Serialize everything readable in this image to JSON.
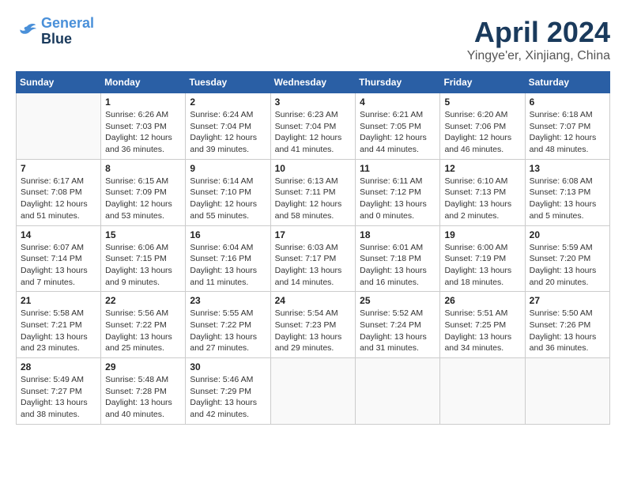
{
  "header": {
    "logo_line1": "General",
    "logo_line2": "Blue",
    "title": "April 2024",
    "location": "Yingye'er, Xinjiang, China"
  },
  "weekdays": [
    "Sunday",
    "Monday",
    "Tuesday",
    "Wednesday",
    "Thursday",
    "Friday",
    "Saturday"
  ],
  "weeks": [
    [
      {
        "day": "",
        "info": ""
      },
      {
        "day": "1",
        "info": "Sunrise: 6:26 AM\nSunset: 7:03 PM\nDaylight: 12 hours\nand 36 minutes."
      },
      {
        "day": "2",
        "info": "Sunrise: 6:24 AM\nSunset: 7:04 PM\nDaylight: 12 hours\nand 39 minutes."
      },
      {
        "day": "3",
        "info": "Sunrise: 6:23 AM\nSunset: 7:04 PM\nDaylight: 12 hours\nand 41 minutes."
      },
      {
        "day": "4",
        "info": "Sunrise: 6:21 AM\nSunset: 7:05 PM\nDaylight: 12 hours\nand 44 minutes."
      },
      {
        "day": "5",
        "info": "Sunrise: 6:20 AM\nSunset: 7:06 PM\nDaylight: 12 hours\nand 46 minutes."
      },
      {
        "day": "6",
        "info": "Sunrise: 6:18 AM\nSunset: 7:07 PM\nDaylight: 12 hours\nand 48 minutes."
      }
    ],
    [
      {
        "day": "7",
        "info": "Sunrise: 6:17 AM\nSunset: 7:08 PM\nDaylight: 12 hours\nand 51 minutes."
      },
      {
        "day": "8",
        "info": "Sunrise: 6:15 AM\nSunset: 7:09 PM\nDaylight: 12 hours\nand 53 minutes."
      },
      {
        "day": "9",
        "info": "Sunrise: 6:14 AM\nSunset: 7:10 PM\nDaylight: 12 hours\nand 55 minutes."
      },
      {
        "day": "10",
        "info": "Sunrise: 6:13 AM\nSunset: 7:11 PM\nDaylight: 12 hours\nand 58 minutes."
      },
      {
        "day": "11",
        "info": "Sunrise: 6:11 AM\nSunset: 7:12 PM\nDaylight: 13 hours\nand 0 minutes."
      },
      {
        "day": "12",
        "info": "Sunrise: 6:10 AM\nSunset: 7:13 PM\nDaylight: 13 hours\nand 2 minutes."
      },
      {
        "day": "13",
        "info": "Sunrise: 6:08 AM\nSunset: 7:13 PM\nDaylight: 13 hours\nand 5 minutes."
      }
    ],
    [
      {
        "day": "14",
        "info": "Sunrise: 6:07 AM\nSunset: 7:14 PM\nDaylight: 13 hours\nand 7 minutes."
      },
      {
        "day": "15",
        "info": "Sunrise: 6:06 AM\nSunset: 7:15 PM\nDaylight: 13 hours\nand 9 minutes."
      },
      {
        "day": "16",
        "info": "Sunrise: 6:04 AM\nSunset: 7:16 PM\nDaylight: 13 hours\nand 11 minutes."
      },
      {
        "day": "17",
        "info": "Sunrise: 6:03 AM\nSunset: 7:17 PM\nDaylight: 13 hours\nand 14 minutes."
      },
      {
        "day": "18",
        "info": "Sunrise: 6:01 AM\nSunset: 7:18 PM\nDaylight: 13 hours\nand 16 minutes."
      },
      {
        "day": "19",
        "info": "Sunrise: 6:00 AM\nSunset: 7:19 PM\nDaylight: 13 hours\nand 18 minutes."
      },
      {
        "day": "20",
        "info": "Sunrise: 5:59 AM\nSunset: 7:20 PM\nDaylight: 13 hours\nand 20 minutes."
      }
    ],
    [
      {
        "day": "21",
        "info": "Sunrise: 5:58 AM\nSunset: 7:21 PM\nDaylight: 13 hours\nand 23 minutes."
      },
      {
        "day": "22",
        "info": "Sunrise: 5:56 AM\nSunset: 7:22 PM\nDaylight: 13 hours\nand 25 minutes."
      },
      {
        "day": "23",
        "info": "Sunrise: 5:55 AM\nSunset: 7:22 PM\nDaylight: 13 hours\nand 27 minutes."
      },
      {
        "day": "24",
        "info": "Sunrise: 5:54 AM\nSunset: 7:23 PM\nDaylight: 13 hours\nand 29 minutes."
      },
      {
        "day": "25",
        "info": "Sunrise: 5:52 AM\nSunset: 7:24 PM\nDaylight: 13 hours\nand 31 minutes."
      },
      {
        "day": "26",
        "info": "Sunrise: 5:51 AM\nSunset: 7:25 PM\nDaylight: 13 hours\nand 34 minutes."
      },
      {
        "day": "27",
        "info": "Sunrise: 5:50 AM\nSunset: 7:26 PM\nDaylight: 13 hours\nand 36 minutes."
      }
    ],
    [
      {
        "day": "28",
        "info": "Sunrise: 5:49 AM\nSunset: 7:27 PM\nDaylight: 13 hours\nand 38 minutes."
      },
      {
        "day": "29",
        "info": "Sunrise: 5:48 AM\nSunset: 7:28 PM\nDaylight: 13 hours\nand 40 minutes."
      },
      {
        "day": "30",
        "info": "Sunrise: 5:46 AM\nSunset: 7:29 PM\nDaylight: 13 hours\nand 42 minutes."
      },
      {
        "day": "",
        "info": ""
      },
      {
        "day": "",
        "info": ""
      },
      {
        "day": "",
        "info": ""
      },
      {
        "day": "",
        "info": ""
      }
    ]
  ]
}
